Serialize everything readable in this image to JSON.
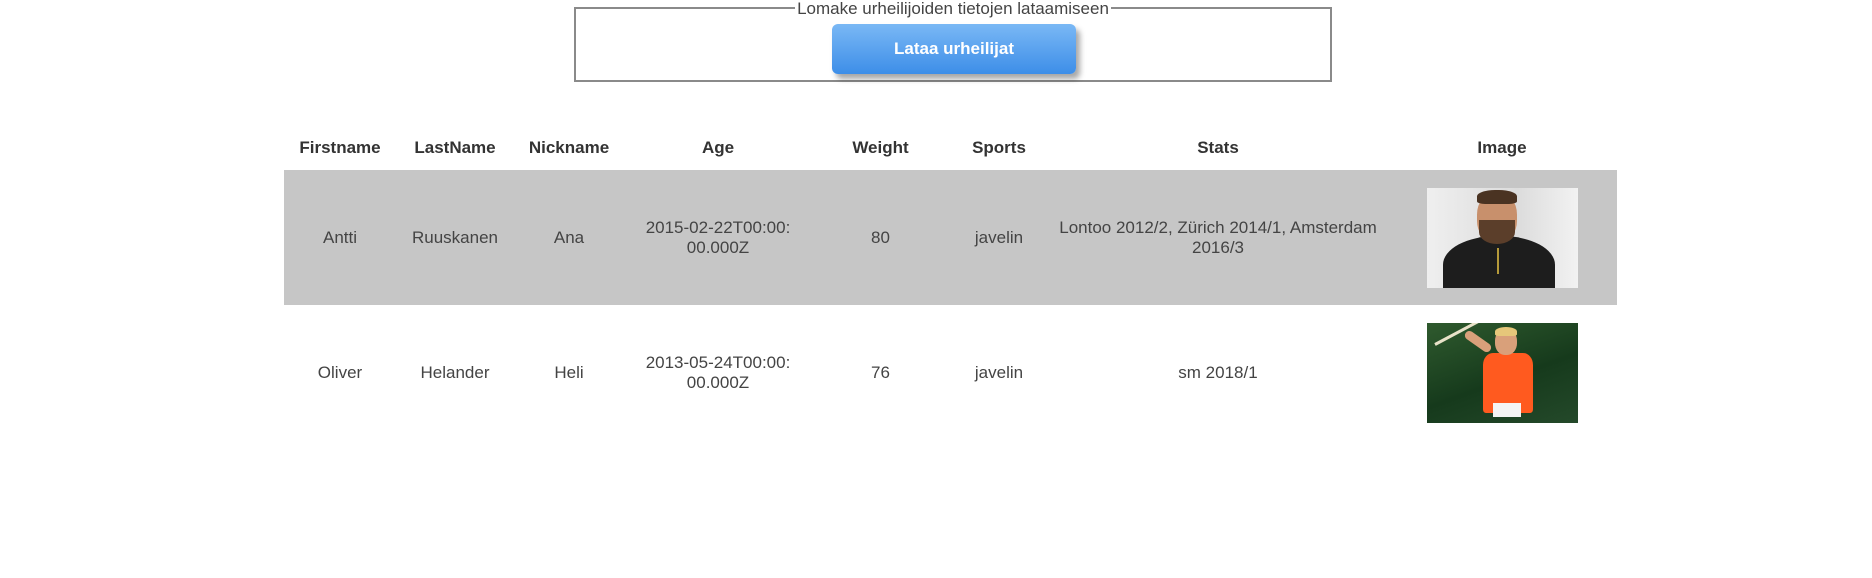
{
  "form": {
    "legend": "Lomake urheilijoiden tietojen lataamiseen",
    "load_button_label": "Lataa urheilijat"
  },
  "table": {
    "headers": {
      "firstname": "Firstname",
      "lastname": "LastName",
      "nickname": "Nickname",
      "age": "Age",
      "weight": "Weight",
      "sports": "Sports",
      "stats": "Stats",
      "image": "Image"
    },
    "rows": [
      {
        "firstname": "Antti",
        "lastname": "Ruuskanen",
        "nickname": "Ana",
        "age": "2015-02-22T00:00:00.000Z",
        "weight": "80",
        "sports": "javelin",
        "stats": "Lontoo 2012/2, Zürich 2014/1, Amsterdam 2016/3",
        "image_icon": "athlete-portrait-photo"
      },
      {
        "firstname": "Oliver",
        "lastname": "Helander",
        "nickname": "Heli",
        "age": "2013-05-24T00:00:00.000Z",
        "weight": "76",
        "sports": "javelin",
        "stats": "sm 2018/1",
        "image_icon": "javelin-thrower-photo"
      }
    ]
  },
  "colors": {
    "button_gradient_top": "#7ab8f5",
    "button_gradient_bottom": "#3d8ee8",
    "highlight_row": "#c6c6c6",
    "fieldset_border": "#8a8a8a"
  }
}
